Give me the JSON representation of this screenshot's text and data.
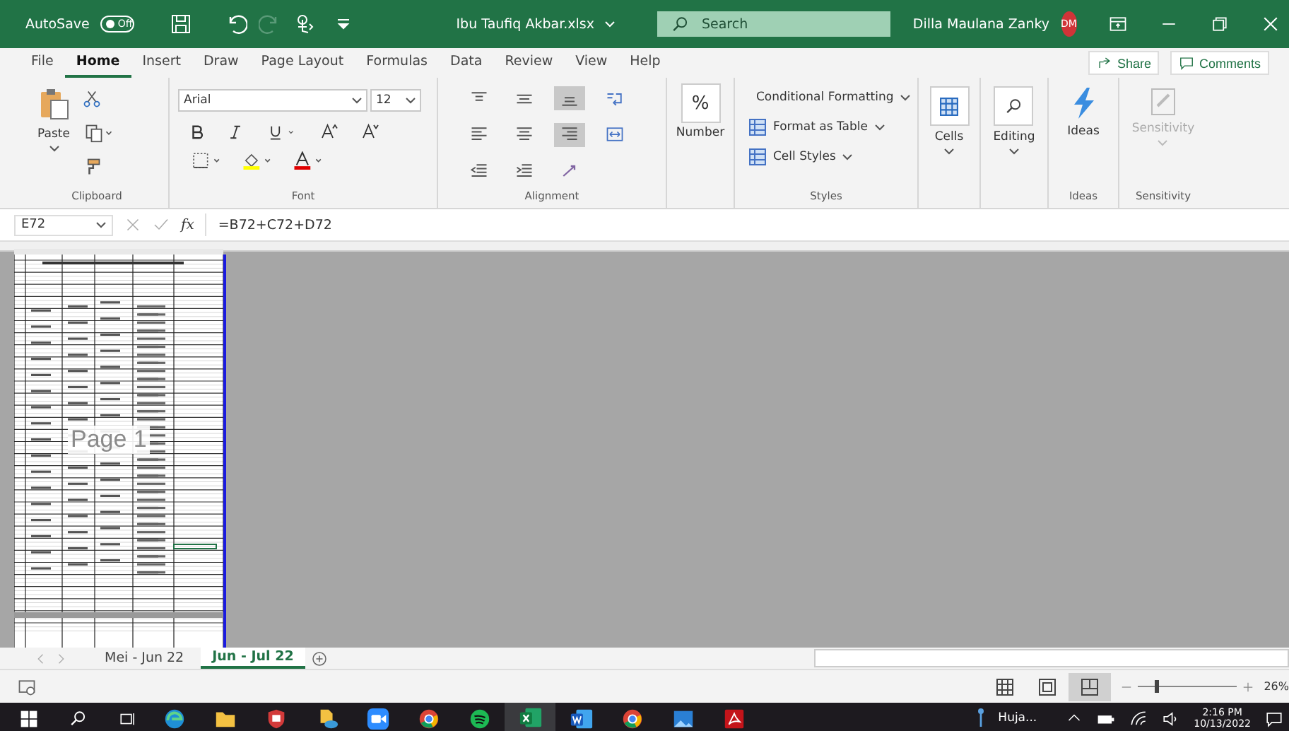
{
  "title_bar": {
    "autosave_label": "AutoSave",
    "autosave_state": "Off",
    "autosave_on": false,
    "file_name": "Ibu Taufiq Akbar.xlsx",
    "search_placeholder": "Search",
    "user_name": "Dilla Maulana Zanky",
    "user_initials": "DM"
  },
  "menu_tabs": [
    {
      "label": "File",
      "selected": false
    },
    {
      "label": "Home",
      "selected": true
    },
    {
      "label": "Insert",
      "selected": false
    },
    {
      "label": "Draw",
      "selected": false
    },
    {
      "label": "Page Layout",
      "selected": false
    },
    {
      "label": "Formulas",
      "selected": false
    },
    {
      "label": "Data",
      "selected": false
    },
    {
      "label": "Review",
      "selected": false
    },
    {
      "label": "View",
      "selected": false
    },
    {
      "label": "Help",
      "selected": false
    }
  ],
  "share_button": "Share",
  "comments_button": "Comments",
  "ribbon": {
    "clipboard": {
      "label": "Clipboard",
      "paste": "Paste"
    },
    "font": {
      "label": "Font",
      "font_name": "Arial",
      "font_size": "12"
    },
    "alignment": {
      "label": "Alignment",
      "buttons": [
        {
          "kind": "align-top",
          "selected": false
        },
        {
          "kind": "align-middle",
          "selected": false
        },
        {
          "kind": "align-bottom",
          "selected": true
        },
        {
          "kind": "wrap",
          "selected": false
        },
        {
          "kind": "align-left",
          "selected": false
        },
        {
          "kind": "align-center",
          "selected": false
        },
        {
          "kind": "align-right",
          "selected": true
        },
        {
          "kind": "merge",
          "selected": false
        },
        {
          "kind": "indent-less",
          "selected": false
        },
        {
          "kind": "indent-more",
          "selected": false
        },
        {
          "kind": "orientation",
          "selected": false
        }
      ]
    },
    "number": {
      "label": "Number",
      "symbol": "%"
    },
    "styles": {
      "label": "Styles",
      "items": [
        "Conditional Formatting",
        "Format as Table",
        "Cell Styles"
      ]
    },
    "cells": {
      "label": "Cells"
    },
    "editing": {
      "label": "Editing"
    },
    "ideas": {
      "button": "Ideas",
      "label": "Ideas"
    },
    "sensitivity": {
      "button": "Sensitivity",
      "label": "Sensitivity",
      "disabled": true
    }
  },
  "formula_bar": {
    "name_box": "E72",
    "function_symbol": "fx",
    "formula": "=B72+C72+D72"
  },
  "sheet": {
    "page_label": "Page 1"
  },
  "sheet_tabs": [
    {
      "label": "Mei - Jun 22",
      "selected": false
    },
    {
      "label": "Jun - Jul 22",
      "selected": true
    }
  ],
  "status_bar": {
    "views": [
      {
        "kind": "normal",
        "selected": false
      },
      {
        "kind": "page-layout",
        "selected": false
      },
      {
        "kind": "page-break",
        "selected": true
      }
    ],
    "zoom": {
      "level": 0.17
    },
    "zoom_text": "26%"
  },
  "taskbar": {
    "apps": [
      {
        "kind": "edge",
        "active": false
      },
      {
        "kind": "folder",
        "active": false
      },
      {
        "kind": "shield",
        "active": false
      },
      {
        "kind": "files",
        "active": false
      },
      {
        "kind": "zoom",
        "active": false
      },
      {
        "kind": "chrome",
        "active": false
      },
      {
        "kind": "spotify",
        "active": false
      },
      {
        "kind": "excel",
        "active": true
      },
      {
        "kind": "word",
        "active": false
      },
      {
        "kind": "chrome",
        "active": false
      },
      {
        "kind": "photos",
        "active": false
      },
      {
        "kind": "pdf",
        "active": false
      }
    ],
    "weather": "Huja...",
    "time": "2:16 PM",
    "date": "10/13/2022"
  }
}
